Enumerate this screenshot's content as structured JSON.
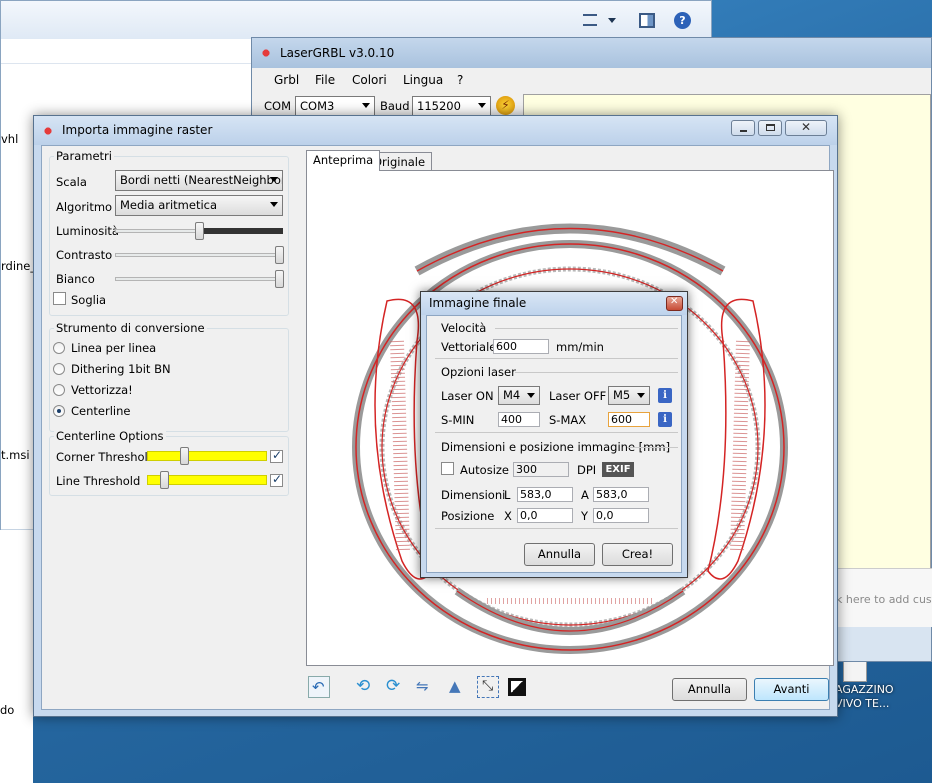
{
  "desktop": {
    "icon_label_line1": "AGAZZINO",
    "icon_label_line2": "VIVO TE..."
  },
  "explorer": {
    "fragments": [
      "vhl",
      "rdine_",
      "t.msi",
      "do"
    ]
  },
  "lasergrbl": {
    "title": "LaserGRBL v3.0.10",
    "menu": [
      "Grbl",
      "File",
      "Colori",
      "Lingua",
      "?"
    ],
    "com_label": "COM",
    "com_value": "COM3",
    "baud_label": "Baud",
    "baud_value": "115200",
    "command_placeholder": "k here to add custo"
  },
  "import_dialog": {
    "title": "Importa immagine raster",
    "params_group": "Parametri",
    "scala_label": "Scala",
    "scala_value": "Bordi netti (NearestNeighbor)",
    "algoritmo_label": "Algoritmo",
    "algoritmo_value": "Media aritmetica",
    "luminosita_label": "Luminosità",
    "contrasto_label": "Contrasto",
    "bianco_label": "Bianco",
    "soglia_label": "Soglia",
    "soglia_checked": false,
    "luminosita_level": 0.5,
    "contrasto_level": 1.0,
    "bianco_level": 1.0,
    "tool_group": "Strumento di conversione",
    "tools": [
      "Linea per linea",
      "Dithering 1bit BN",
      "Vettorizza!",
      "Centerline"
    ],
    "selected_tool": "Centerline",
    "centerline_group": "Centerline Options",
    "corner_threshold_label": "Corner Threshold",
    "line_threshold_label": "Line Threshold",
    "corner_threshold_level": 0.3,
    "line_threshold_level": 0.12,
    "corner_checked": true,
    "line_checked": true,
    "tab_preview": "Anteprima",
    "tab_original": "Originale",
    "cancel": "Annulla",
    "next": "Avanti"
  },
  "final_dialog": {
    "title": "Immagine finale",
    "speed_group": "Velocità",
    "vettoriale_label": "Vettoriale",
    "vettoriale_value": "600",
    "speed_unit": "mm/min",
    "laser_group": "Opzioni laser",
    "laser_on_label": "Laser ON",
    "laser_on_value": "M4",
    "laser_off_label": "Laser OFF",
    "laser_off_value": "M5",
    "smin_label": "S-MIN",
    "smin_value": "400",
    "smax_label": "S-MAX",
    "smax_value": "600",
    "dim_group": "Dimensioni e posizione immagine [mm]",
    "autosize_label": "Autosize",
    "autosize_value": "300",
    "dpi_label": "DPI",
    "exif_label": "EXIF",
    "dimensioni_label": "Dimensioni",
    "l_label": "L",
    "l_value": "583,0",
    "a_label": "A",
    "a_value": "583,0",
    "posizione_label": "Posizione",
    "x_label": "X",
    "x_value": "0,0",
    "y_label": "Y",
    "y_value": "0,0",
    "cancel": "Annulla",
    "create": "Crea!"
  },
  "colors": {
    "preview_trace": "#d42424",
    "preview_fill": "#9a9a9a",
    "slider_yellow": "#ffff00"
  }
}
